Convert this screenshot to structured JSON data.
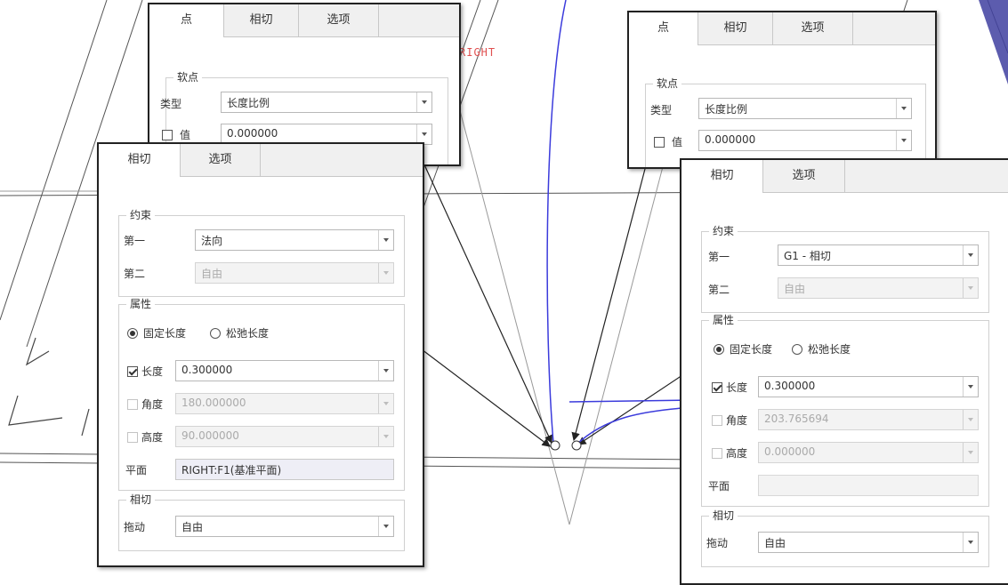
{
  "colors": {
    "curve_blue": "#3b3bdc",
    "accent_navy": "#4040a0",
    "label_red": "#e05050"
  },
  "canvas": {
    "plane_label": "RIGHT"
  },
  "dialog_point_left": {
    "tabs": [
      "点",
      "相切",
      "选项"
    ],
    "soft_point": {
      "title": "软点",
      "type_label": "类型",
      "type_value": "长度比例",
      "value_label": "值",
      "value_value": "0.000000"
    }
  },
  "dialog_point_right": {
    "tabs": [
      "点",
      "相切",
      "选项"
    ],
    "soft_point": {
      "title": "软点",
      "type_label": "类型",
      "type_value": "长度比例",
      "value_label": "值",
      "value_value": "0.000000"
    }
  },
  "dialog_tangent_left": {
    "tabs": [
      "相切",
      "选项"
    ],
    "constraint": {
      "title": "约束",
      "first_label": "第一",
      "first_value": "法向",
      "second_label": "第二",
      "second_value": "自由"
    },
    "properties": {
      "title": "属性",
      "radio_fixed": "固定长度",
      "radio_relaxed": "松弛长度",
      "length_label": "长度",
      "length_value": "0.300000",
      "angle_label": "角度",
      "angle_value": "180.000000",
      "height_label": "高度",
      "height_value": "90.000000",
      "plane_label": "平面",
      "plane_value": "RIGHT:F1(基准平面)"
    },
    "tangent": {
      "title": "相切",
      "drag_label": "拖动",
      "drag_value": "自由"
    }
  },
  "dialog_tangent_right": {
    "tabs": [
      "相切",
      "选项"
    ],
    "constraint": {
      "title": "约束",
      "first_label": "第一",
      "first_value": "G1 - 相切",
      "second_label": "第二",
      "second_value": "自由"
    },
    "properties": {
      "title": "属性",
      "radio_fixed": "固定长度",
      "radio_relaxed": "松弛长度",
      "length_label": "长度",
      "length_value": "0.300000",
      "angle_label": "角度",
      "angle_value": "203.765694",
      "height_label": "高度",
      "height_value": "0.000000",
      "plane_label": "平面",
      "plane_value": ""
    },
    "tangent": {
      "title": "相切",
      "drag_label": "拖动",
      "drag_value": "自由"
    }
  }
}
